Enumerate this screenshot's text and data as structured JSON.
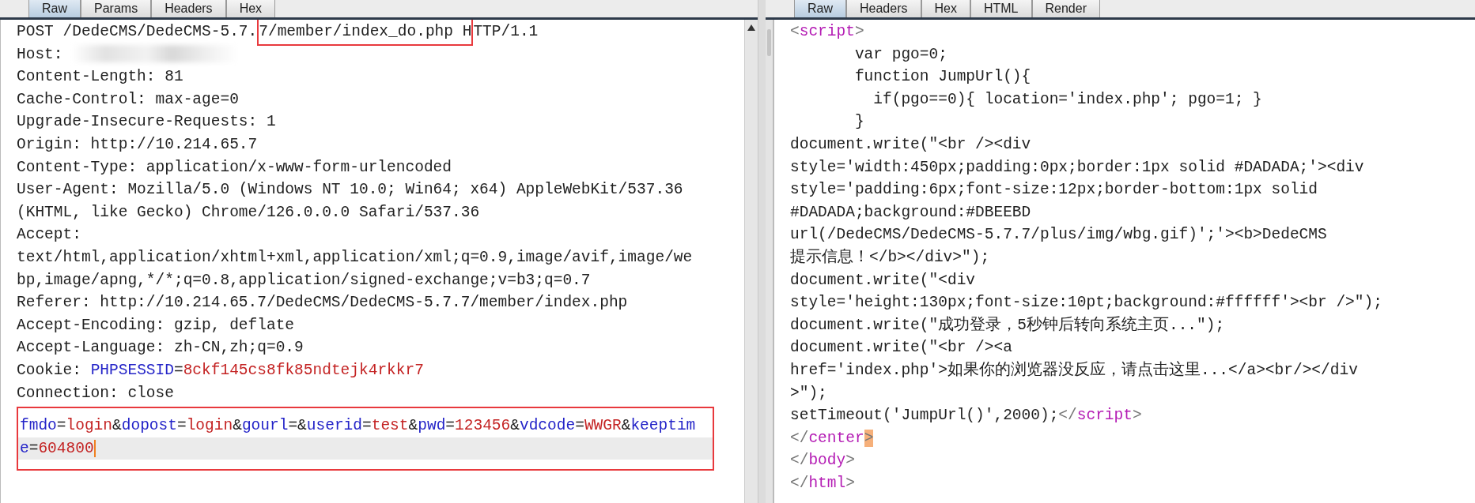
{
  "request": {
    "tabs": [
      {
        "label": "Raw",
        "selected": true
      },
      {
        "label": "Params",
        "selected": false
      },
      {
        "label": "Headers",
        "selected": false
      },
      {
        "label": "Hex",
        "selected": false
      }
    ],
    "lines": [
      {
        "segments": [
          {
            "text": "POST /DedeCMS/DedeCMS-5.7.",
            "kind": "plain"
          },
          {
            "text": "7/member/index_do.php H",
            "kind": "plain",
            "framed": true
          },
          {
            "text": "TTP/1.1",
            "kind": "plain"
          }
        ]
      },
      {
        "segments": [
          {
            "text": "Host: ",
            "kind": "plain"
          },
          {
            "kind": "redacted"
          }
        ]
      },
      "Content-Length: 81",
      "Cache-Control: max-age=0",
      "Upgrade-Insecure-Requests: 1",
      "Origin: http://10.214.65.7",
      "Content-Type: application/x-www-form-urlencoded",
      "User-Agent: Mozilla/5.0 (Windows NT 10.0; Win64; x64) AppleWebKit/537.36",
      "(KHTML, like Gecko) Chrome/126.0.0.0 Safari/537.36",
      "Accept:",
      "text/html,application/xhtml+xml,application/xml;q=0.9,image/avif,image/we",
      "bp,image/apng,*/*;q=0.8,application/signed-exchange;v=b3;q=0.7",
      "Referer: http://10.214.65.7/DedeCMS/DedeCMS-5.7.7/member/index.php",
      "Accept-Encoding: gzip, deflate",
      "Accept-Language: zh-CN,zh;q=0.9",
      {
        "segments": [
          {
            "text": "Cookie: ",
            "kind": "plain"
          },
          {
            "text": "PHPSESSID",
            "kind": "key"
          },
          {
            "text": "=",
            "kind": "plain"
          },
          {
            "text": "8ckf145cs8fk85ndtejk4rkkr7",
            "kind": "value"
          }
        ]
      },
      "Connection: close"
    ],
    "body": {
      "framed": true,
      "lines": [
        {
          "current": false,
          "segments": [
            {
              "text": "fmdo",
              "kind": "key"
            },
            {
              "text": "=",
              "kind": "plain"
            },
            {
              "text": "login",
              "kind": "value"
            },
            {
              "text": "&",
              "kind": "plain"
            },
            {
              "text": "dopost",
              "kind": "key"
            },
            {
              "text": "=",
              "kind": "plain"
            },
            {
              "text": "login",
              "kind": "value"
            },
            {
              "text": "&",
              "kind": "plain"
            },
            {
              "text": "gourl",
              "kind": "key"
            },
            {
              "text": "=&",
              "kind": "plain"
            },
            {
              "text": "userid",
              "kind": "key"
            },
            {
              "text": "=",
              "kind": "plain"
            },
            {
              "text": "test",
              "kind": "value"
            },
            {
              "text": "&",
              "kind": "plain"
            },
            {
              "text": "pwd",
              "kind": "key"
            },
            {
              "text": "=",
              "kind": "plain"
            },
            {
              "text": "123456",
              "kind": "value"
            },
            {
              "text": "&",
              "kind": "plain"
            },
            {
              "text": "vdcode",
              "kind": "key"
            },
            {
              "text": "=",
              "kind": "plain"
            },
            {
              "text": "WWGR",
              "kind": "value"
            },
            {
              "text": "&",
              "kind": "plain"
            },
            {
              "text": "keeptim",
              "kind": "key"
            }
          ]
        },
        {
          "current": true,
          "segments": [
            {
              "text": "e",
              "kind": "key"
            },
            {
              "text": "=",
              "kind": "plain"
            },
            {
              "text": "604800",
              "kind": "value"
            }
          ]
        }
      ]
    }
  },
  "response": {
    "tabs": [
      {
        "label": "Raw",
        "selected": true
      },
      {
        "label": "Headers",
        "selected": false
      },
      {
        "label": "Hex",
        "selected": false
      },
      {
        "label": "HTML",
        "selected": false
      },
      {
        "label": "Render",
        "selected": false
      }
    ],
    "lines": [
      {
        "segments": [
          {
            "text": "<",
            "kind": "punct"
          },
          {
            "text": "script",
            "kind": "tag"
          },
          {
            "text": ">",
            "kind": "punct"
          }
        ]
      },
      "       var pgo=0;",
      "       function JumpUrl(){",
      "         if(pgo==0){ location='index.php'; pgo=1; }",
      "       }",
      "document.write(\"<br /><div",
      "style='width:450px;padding:0px;border:1px solid #DADADA;'><div",
      "style='padding:6px;font-size:12px;border-bottom:1px solid",
      "#DADADA;background:#DBEEBD",
      "url(/DedeCMS/DedeCMS-5.7.7/plus/img/wbg.gif)';'><b>DedeCMS",
      "提示信息！</b></div>\");",
      "document.write(\"<div",
      "style='height:130px;font-size:10pt;background:#ffffff'><br />\");",
      "document.write(\"成功登录，5秒钟后转向系统主页...\");",
      "document.write(\"<br /><a",
      "href='index.php'>如果你的浏览器没反应，请点击这里...</a><br/></div",
      ">\");",
      {
        "segments": [
          {
            "text": "setTimeout('JumpUrl()',2000);",
            "kind": "plain"
          },
          {
            "text": "</",
            "kind": "punct"
          },
          {
            "text": "script",
            "kind": "tag"
          },
          {
            "text": ">",
            "kind": "punct"
          }
        ]
      },
      {
        "segments": [
          {
            "text": "</",
            "kind": "punct"
          },
          {
            "text": "center",
            "kind": "tag"
          },
          {
            "text": ">",
            "kind": "match"
          }
        ]
      },
      {
        "segments": [
          {
            "text": "</",
            "kind": "punct"
          },
          {
            "text": "body",
            "kind": "tag"
          },
          {
            "text": ">",
            "kind": "punct"
          }
        ]
      },
      {
        "segments": [
          {
            "text": "</",
            "kind": "punct"
          },
          {
            "text": "html",
            "kind": "tag"
          },
          {
            "text": ">",
            "kind": "punct"
          }
        ]
      }
    ]
  }
}
